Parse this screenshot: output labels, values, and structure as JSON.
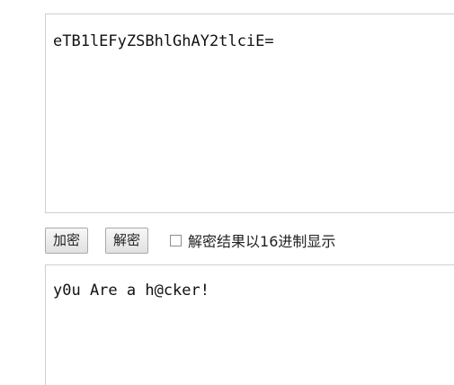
{
  "input": {
    "value": "eTB1lEFyZSBhlGhAY2tlciE="
  },
  "actions": {
    "encrypt_label": "加密",
    "decrypt_label": "解密"
  },
  "options": {
    "hex_display_label": "解密结果以16进制显示",
    "hex_display_checked": false
  },
  "output": {
    "value": "y0u Are a h@cker!"
  }
}
